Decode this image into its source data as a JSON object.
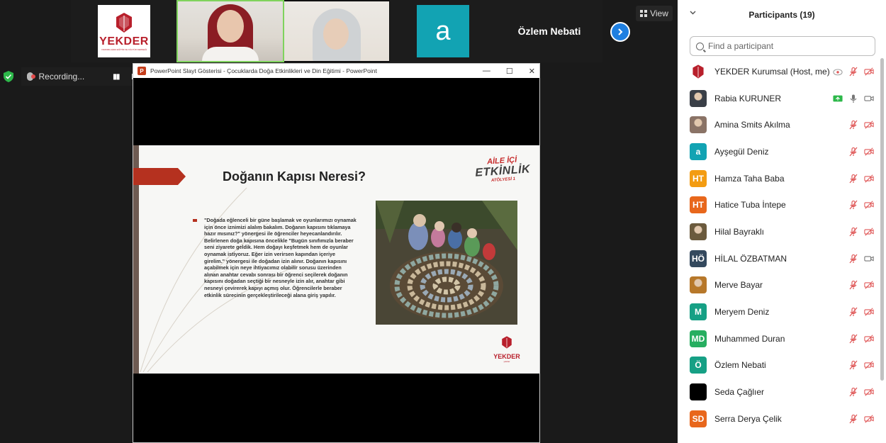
{
  "gallery": {
    "tile_name_label": "Özlem Nebati",
    "avatar_letter": "a",
    "logo_text": "YEKDER",
    "logo_subtext": "YARDIMLAŞMA EĞİTİM VE KÜLTÜR DERNEĞİ",
    "view_label": "View"
  },
  "recording": {
    "label": "Recording..."
  },
  "ppt": {
    "window_title": "PowerPoint Slayt Gösterisi  -  Çocuklarda Doğa Etkinlikleri ve Din Eğitimi  -  PowerPoint",
    "slide": {
      "title": "Doğanın Kapısı Neresi?",
      "body": "\"Doğada eğlenceli bir güne başlamak ve oyunlarımızı oynamak için önce iznimizi alalım bakalım. Doğanın kapısını tıklamaya hazır mısınız?\" yönergesi ile öğrenciler heyecanlandırılır. Belirlenen doğa kapısına öncelikle \"Bugün sınıfımızla beraber seni ziyarete geldik. Hem doğayı keşfetmek hem de oyunlar oynamak istiyoruz. Eğer izin verirsen kapından içeriye girelim.\" yönergesi ile doğadan izin alınır. Doğanın kapısını açabilmek için neye ihtiyacımız olabilir sorusu üzerinden alınan anahtar cevabı sonrası bir öğrenci seçilerek doğanın kapısını doğadan seçtiği bir nesneyle izin alır, anahtar gibi nesneyi çevirerek kapıyı açmış olur. Öğrencilerle beraber etkinlik sürecinin gerçekleştirileceği alana giriş yapılır.",
      "badge_line1": "AİLE İÇİ",
      "badge_line2": "ETKİNLİK",
      "badge_line3": "ATÖLYESİ 1",
      "logo_text": "YEKDER",
      "logo_subtext": "yekder"
    }
  },
  "participants": {
    "title": "Participants (19)",
    "search_placeholder": "Find a participant",
    "list": [
      {
        "name": "YEKDER Kurumsal (Host, me)",
        "initials": "",
        "color": "#ffffff",
        "kind": "logo",
        "video": "cloud"
      },
      {
        "name": "Rabia KURUNER",
        "initials": "",
        "color": "#3a3f47",
        "kind": "photo",
        "video": "share"
      },
      {
        "name": "Amina Smits Akılma",
        "initials": "",
        "color": "#8a7366",
        "kind": "photo",
        "video": "off"
      },
      {
        "name": "Ayşegül Deniz",
        "initials": "a",
        "color": "#12a3b3",
        "kind": "initial",
        "video": "off"
      },
      {
        "name": "Hamza Taha Baba",
        "initials": "HT",
        "color": "#f39c12",
        "kind": "initial",
        "video": "off"
      },
      {
        "name": "Hatice Tuba İntepe",
        "initials": "HT",
        "color": "#e8671c",
        "kind": "initial",
        "video": "off"
      },
      {
        "name": "Hilal Bayraklı",
        "initials": "",
        "color": "#6b5a3d",
        "kind": "photo",
        "video": "off"
      },
      {
        "name": "HİLAL ÖZBATMAN",
        "initials": "HÖ",
        "color": "#34495e",
        "kind": "initial",
        "video": "on"
      },
      {
        "name": "Merve Bayar",
        "initials": "",
        "color": "#b7782a",
        "kind": "photo",
        "video": "off"
      },
      {
        "name": "Meryem Deniz",
        "initials": "M",
        "color": "#16a085",
        "kind": "initial",
        "video": "off"
      },
      {
        "name": "Muhammed Duran",
        "initials": "MD",
        "color": "#27ae60",
        "kind": "initial",
        "video": "off"
      },
      {
        "name": "Özlem Nebati",
        "initials": "Ö",
        "color": "#16a085",
        "kind": "initial",
        "video": "off"
      },
      {
        "name": "Seda Çağlıer",
        "initials": "",
        "color": "#000000",
        "kind": "initial",
        "video": "off"
      },
      {
        "name": "Serra Derya Çelik",
        "initials": "SD",
        "color": "#e8671c",
        "kind": "initial",
        "video": "off"
      }
    ]
  },
  "colors": {
    "accent_blue": "#1f7fe0",
    "brand_red": "#b81f2b",
    "muted_red": "#e05a5a",
    "share_green": "#2db84a"
  }
}
